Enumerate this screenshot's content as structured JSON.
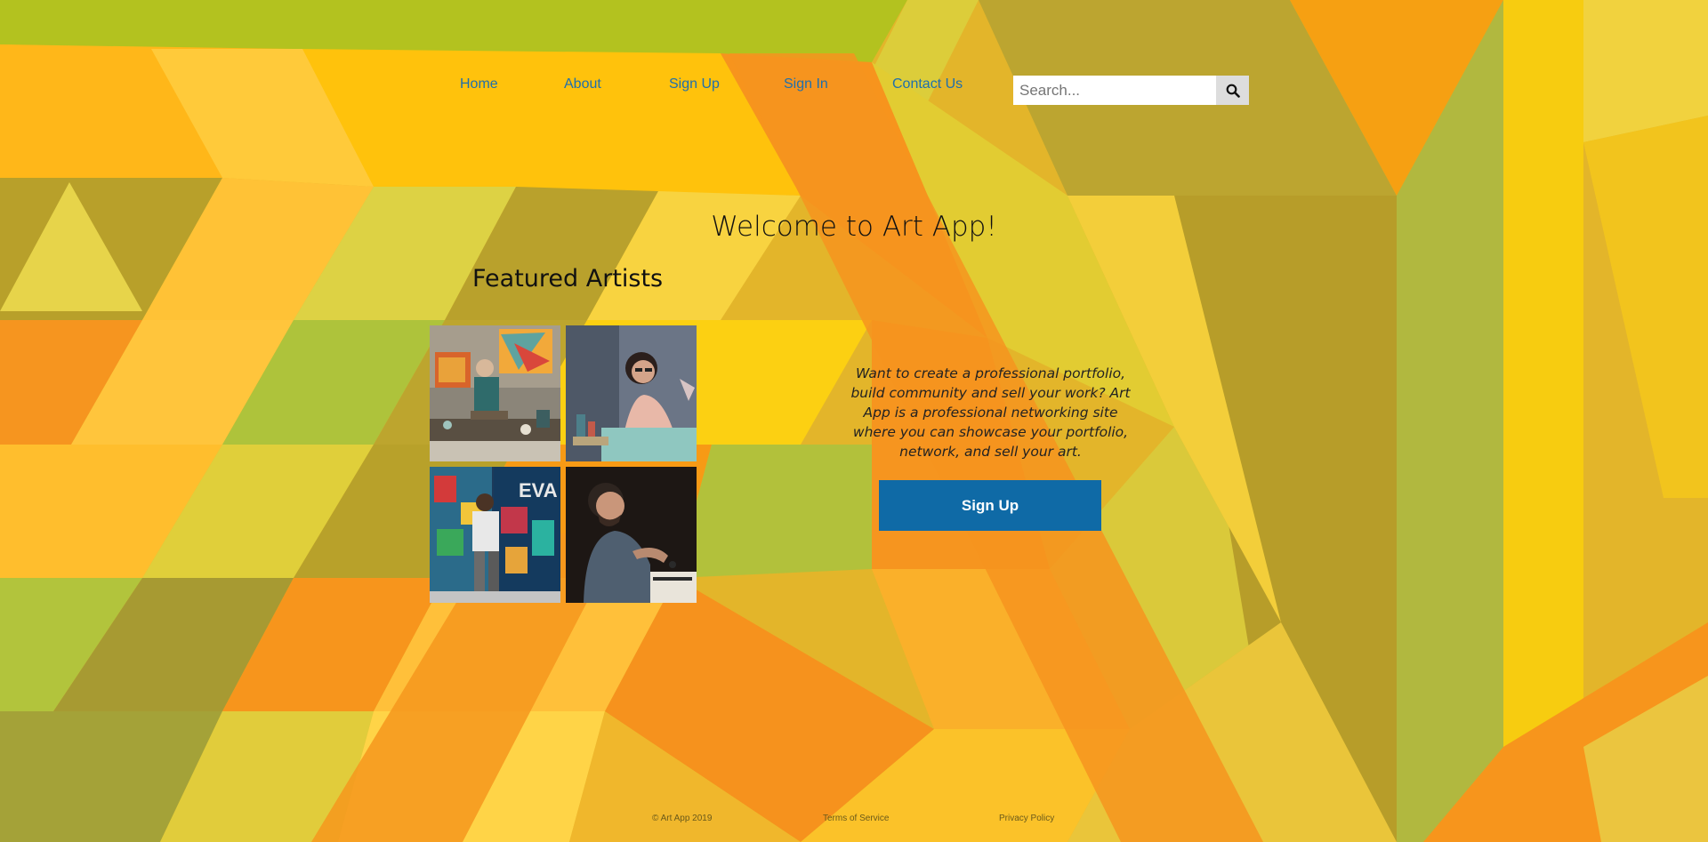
{
  "nav": {
    "items": [
      {
        "label": "Home"
      },
      {
        "label": "About"
      },
      {
        "label": "Sign Up"
      },
      {
        "label": "Sign In"
      },
      {
        "label": "Contact Us"
      }
    ]
  },
  "search": {
    "placeholder": "Search...",
    "value": "",
    "button_icon": "search-icon"
  },
  "hero": {
    "title": "Welcome to Art App!",
    "tagline": "Want to create a professional portfolio, build community and sell your work? Art App is a professional networking site where you can showcase your portfolio, network, and sell your art.",
    "cta_label": "Sign Up"
  },
  "featured": {
    "heading": "Featured Artists"
  },
  "footer": {
    "copyright": "© Art App 2019",
    "terms": "Terms of Service",
    "privacy": "Privacy Policy"
  },
  "colors": {
    "nav_link": "#1f6fad",
    "cta_bg": "#0f6aa6",
    "background_orange": "#f7941d",
    "background_yellow": "#fbc02d",
    "background_olive": "#b8a02a",
    "background_green": "#aebf3c"
  }
}
